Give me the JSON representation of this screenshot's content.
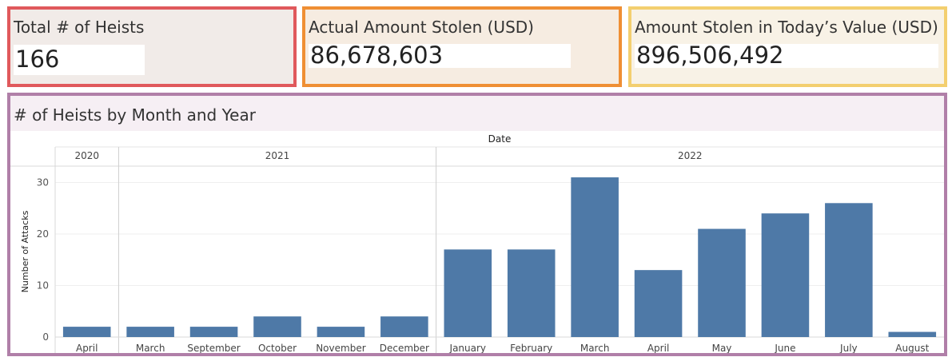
{
  "kpis": [
    {
      "title": "Total # of Heists",
      "value": "166",
      "border": "#e0595c",
      "bg": "#f1ebe8"
    },
    {
      "title": "Actual Amount Stolen (USD)",
      "value": "86,678,603",
      "border": "#ef8f34",
      "bg": "#f6ece1"
    },
    {
      "title": "Amount Stolen in Today’s Value (USD)",
      "value": "896,506,492",
      "border": "#f3cf6f",
      "bg": "#f8f2e6"
    }
  ],
  "chart_panel": {
    "border": "#b07fa8",
    "title_band": "#f6eff4"
  },
  "chart_data": {
    "type": "bar",
    "title": "# of Heists by Month and Year",
    "column_header": "Date",
    "ylabel": "Number of Attacks",
    "xlabel": "",
    "ylim": [
      0,
      32
    ],
    "yticks": [
      0,
      10,
      20,
      30
    ],
    "grid": true,
    "bar_color": "#4e79a7",
    "years": [
      {
        "year": "2020",
        "months": [
          "April"
        ]
      },
      {
        "year": "2021",
        "months": [
          "March",
          "September",
          "October",
          "November",
          "December"
        ]
      },
      {
        "year": "2022",
        "months": [
          "January",
          "February",
          "March",
          "April",
          "May",
          "June",
          "July",
          "August"
        ]
      }
    ],
    "categories": [
      "April",
      "March",
      "September",
      "October",
      "November",
      "December",
      "January",
      "February",
      "March",
      "April",
      "May",
      "June",
      "July",
      "August"
    ],
    "values": [
      2,
      2,
      2,
      4,
      2,
      4,
      17,
      17,
      31,
      13,
      21,
      24,
      26,
      1
    ]
  }
}
